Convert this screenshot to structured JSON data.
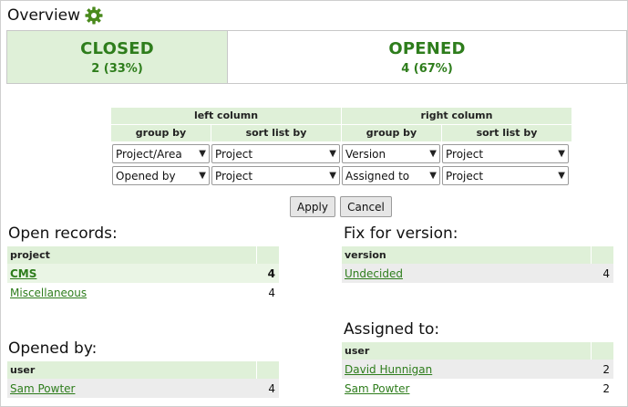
{
  "header": {
    "title": "Overview",
    "settings_icon": "gear-icon",
    "accent": "#4a8a1d"
  },
  "status": {
    "closed": {
      "label": "CLOSED",
      "count": "2 (33%)"
    },
    "opened": {
      "label": "OPENED",
      "count": "4 (67%)"
    }
  },
  "config": {
    "left_column": "left column",
    "right_column": "right column",
    "group_by": "group by",
    "sort_list_by": "sort list by",
    "rows": [
      {
        "left_group": "Project/Area",
        "left_sort": "Project",
        "right_group": "Version",
        "right_sort": "Project"
      },
      {
        "left_group": "Opened by",
        "left_sort": "Project",
        "right_group": "Assigned to",
        "right_sort": "Project"
      }
    ]
  },
  "buttons": {
    "apply": "Apply",
    "cancel": "Cancel"
  },
  "open_records": {
    "title": "Open records:",
    "column": "project",
    "rows": [
      {
        "name": "CMS",
        "count": "4"
      },
      {
        "name": "Miscellaneous",
        "count": "4"
      }
    ]
  },
  "fix_for_version": {
    "title": "Fix for version:",
    "column": "version",
    "rows": [
      {
        "name": "Undecided",
        "count": "4"
      }
    ]
  },
  "opened_by": {
    "title": "Opened by:",
    "column": "user",
    "rows": [
      {
        "name": "Sam Powter",
        "count": "4"
      }
    ]
  },
  "assigned_to": {
    "title": "Assigned to:",
    "column": "user",
    "rows": [
      {
        "name": "David Hunnigan",
        "count": "2"
      },
      {
        "name": "Sam Powter",
        "count": "2"
      }
    ]
  }
}
